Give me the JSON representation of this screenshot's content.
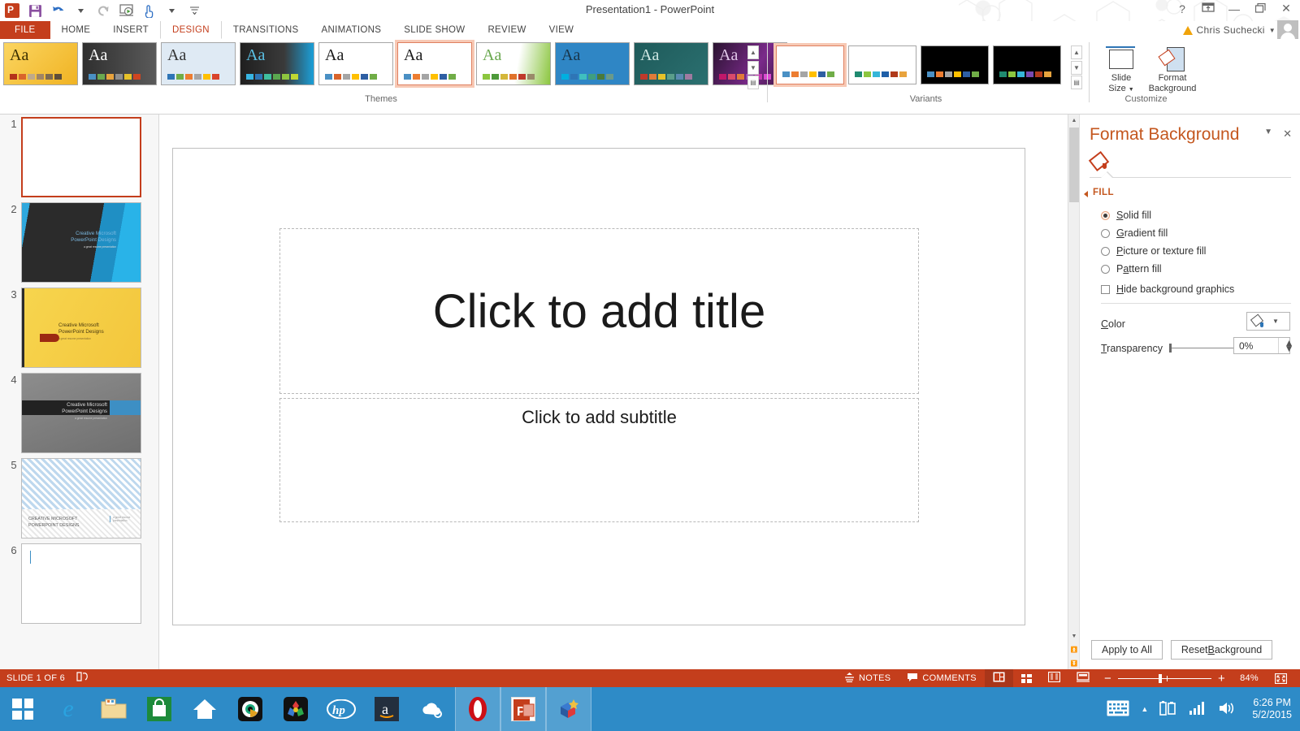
{
  "window": {
    "title": "Presentation1 - PowerPoint",
    "account_name": "Chris Suchecki",
    "help_icon": "?",
    "ribbon_display_icon": "ribbon-display-options-icon",
    "minimize_icon": "—",
    "restore_icon": "❐",
    "close_icon": "✕"
  },
  "quick_access": {
    "items": [
      {
        "name": "powerpoint-logo",
        "glyph": "P"
      },
      {
        "name": "save-icon",
        "glyph": "ὋE"
      },
      {
        "name": "undo-icon",
        "glyph": "↶"
      },
      {
        "name": "redo-icon",
        "glyph": "↻"
      },
      {
        "name": "start-slideshow-icon",
        "glyph": "▷"
      },
      {
        "name": "touch-mode-icon",
        "glyph": "☝"
      },
      {
        "name": "customize-qat-icon",
        "glyph": "≡"
      }
    ]
  },
  "tabs": {
    "file": "FILE",
    "items": [
      "HOME",
      "INSERT",
      "DESIGN",
      "TRANSITIONS",
      "ANIMATIONS",
      "SLIDE SHOW",
      "REVIEW",
      "VIEW"
    ],
    "active": "DESIGN"
  },
  "ribbon": {
    "groups": {
      "themes_label": "Themes",
      "variants_label": "Variants",
      "customize_label": "Customize"
    },
    "themes": [
      {
        "name": "theme-facet-gold",
        "aa": "Aa",
        "bg": "linear-gradient(135deg,#fbd560,#f0b323)",
        "aa_color": "#3b2f00",
        "swatches": [
          "#b5321a",
          "#d9642b",
          "#bfa98a",
          "#a08565",
          "#7d6a4f",
          "#5e4e39"
        ],
        "selected": false
      },
      {
        "name": "theme-ion-dark",
        "aa": "Aa",
        "bg": "linear-gradient(90deg,#2f2f2f,#5a5a5a)",
        "aa_color": "#ffffff",
        "swatches": [
          "#4a90c4",
          "#6aa84f",
          "#e8a33d",
          "#8f8f8f",
          "#e6c229",
          "#cf4520"
        ],
        "selected": false
      },
      {
        "name": "theme-wisp-pattern",
        "aa": "Aa",
        "bg": "#dfeaf4",
        "aa_color": "#333333",
        "swatches": [
          "#2e75b6",
          "#70ad47",
          "#ed7d31",
          "#a5a5a5",
          "#ffc000",
          "#d9442b"
        ],
        "selected": false
      },
      {
        "name": "theme-facet-blue",
        "aa": "Aa",
        "bg": "linear-gradient(90deg,#1f1f1f,#3a3a3a 60%,#1b9fd8)",
        "aa_color": "#5bc2e7",
        "swatches": [
          "#38b6e3",
          "#2e75b6",
          "#3fbf9f",
          "#5aa84f",
          "#8ec63f",
          "#bfd733"
        ],
        "selected": false
      },
      {
        "name": "theme-office-white",
        "aa": "Aa",
        "bg": "#ffffff",
        "aa_color": "#1a1a1a",
        "swatches": [
          "#4a90c4",
          "#d9642b",
          "#a5a5a5",
          "#ffc000",
          "#2e5fa3",
          "#70ad47"
        ],
        "selected": false
      },
      {
        "name": "theme-office-plain",
        "aa": "Aa",
        "bg": "#ffffff",
        "aa_color": "#1a1a1a",
        "swatches": [
          "#4a90c4",
          "#ed7d31",
          "#a5a5a5",
          "#ffc000",
          "#2e5fa3",
          "#70ad47"
        ],
        "selected": true
      },
      {
        "name": "theme-organic-green",
        "aa": "Aa",
        "bg": "linear-gradient(100deg,#ffffff 55%,#d7ebc0 70%,#8cc63f)",
        "aa_color": "#6aa84f",
        "swatches": [
          "#8cc63f",
          "#4e9a3a",
          "#d4b73a",
          "#e0722a",
          "#c0392b",
          "#9a8a6a"
        ],
        "selected": false
      },
      {
        "name": "theme-ion-boardroom",
        "aa": "Aa",
        "bg": "#2f86c5",
        "aa_color": "#18354a",
        "swatches": [
          "#00b0e0",
          "#2e75b6",
          "#3fbfbf",
          "#3f9e7f",
          "#4a7a3a",
          "#6a9a8a"
        ],
        "selected": false
      },
      {
        "name": "theme-retrospect-teal",
        "aa": "Aa",
        "bg": "linear-gradient(135deg,#1e5a5a,#2b7070)",
        "aa_color": "#cfe8e4",
        "swatches": [
          "#c0392b",
          "#e07b39",
          "#e6c229",
          "#5a9e8a",
          "#5a8ab0",
          "#a07aa0"
        ],
        "selected": false
      },
      {
        "name": "theme-slice-purple",
        "aa": "Aa",
        "bg": "linear-gradient(120deg,#2a1330,#7a2a8a 60%,#3a1540)",
        "aa_color": "#e2c8ea",
        "swatches": [
          "#c0186a",
          "#d94a6a",
          "#e07b39",
          "#9a4ab0",
          "#c43ab0",
          "#d94ad0"
        ],
        "selected": false
      }
    ],
    "variants": [
      {
        "name": "variant-light-1",
        "bg": "#ffffff",
        "swatches": [
          "#4a90c4",
          "#ed7d31",
          "#a5a5a5",
          "#ffc000",
          "#2e5fa3",
          "#70ad47"
        ],
        "selected": true
      },
      {
        "name": "variant-light-2",
        "bg": "#ffffff",
        "swatches": [
          "#1f8a70",
          "#8cc63f",
          "#35b6d8",
          "#1f5fa8",
          "#b03a1a",
          "#e8a33d"
        ],
        "selected": false
      },
      {
        "name": "variant-dark-1",
        "bg": "#000000",
        "swatches": [
          "#4a90c4",
          "#ed7d31",
          "#a5a5a5",
          "#ffc000",
          "#2e5fa3",
          "#70ad47"
        ],
        "selected": false
      },
      {
        "name": "variant-dark-2",
        "bg": "#000000",
        "swatches": [
          "#1f8a70",
          "#8cc63f",
          "#35b6d8",
          "#7a4ab0",
          "#b03a1a",
          "#e8a33d"
        ],
        "selected": false
      }
    ],
    "customize": {
      "slide_size_label_1": "Slide",
      "slide_size_label_2": "Size",
      "format_background_label_1": "Format",
      "format_background_label_2": "Background"
    }
  },
  "thumbnails": [
    {
      "num": "1",
      "name": "slide-thumb-1",
      "selected": true,
      "style": "blank",
      "title_line1": "",
      "title_line2": "",
      "subtitle": ""
    },
    {
      "num": "2",
      "name": "slide-thumb-2",
      "selected": false,
      "style": "facet-blue",
      "title_line1": "Creative Microsoft",
      "title_line2": "PowerPoint Designs",
      "subtitle": "a great resume presentation"
    },
    {
      "num": "3",
      "name": "slide-thumb-3",
      "selected": false,
      "style": "gold",
      "title_line1": "Creative Microsoft",
      "title_line2": "PowerPoint Designs",
      "subtitle": "a great resume presentation"
    },
    {
      "num": "4",
      "name": "slide-thumb-4",
      "selected": false,
      "style": "gray",
      "title_line1": "Creative Microsoft",
      "title_line2": "PowerPoint Designs",
      "subtitle": "a great resume presentation"
    },
    {
      "num": "5",
      "name": "slide-thumb-5",
      "selected": false,
      "style": "pattern",
      "title_line1": "CREATIVE MICROSOFT",
      "title_line2": "POWERPOINT DESIGNS",
      "subtitle": "a great resume presentation"
    },
    {
      "num": "6",
      "name": "slide-thumb-6",
      "selected": false,
      "style": "blank",
      "title_line1": "",
      "title_line2": "",
      "subtitle": ""
    }
  ],
  "slide": {
    "title_placeholder": "Click to add title",
    "subtitle_placeholder": "Click to add subtitle"
  },
  "format_background": {
    "title": "Format Background",
    "collapse_caret": "▼",
    "close": "✕",
    "fill_section_label": "FILL",
    "options": [
      {
        "name": "solid-fill-radio",
        "label_pre": "",
        "label_u": "S",
        "label_post": "olid fill",
        "checked": true
      },
      {
        "name": "gradient-fill-radio",
        "label_pre": "",
        "label_u": "G",
        "label_post": "radient fill",
        "checked": false
      },
      {
        "name": "picture-texture-fill-radio",
        "label_pre": "",
        "label_u": "P",
        "label_post": "icture or texture fill",
        "checked": false
      },
      {
        "name": "pattern-fill-radio",
        "label_pre": "P",
        "label_u": "a",
        "label_post": "ttern fill",
        "checked": false
      }
    ],
    "hide_graphics": {
      "pre": "",
      "u": "H",
      "post": "ide background graphics",
      "checked": false
    },
    "color_label_u": "C",
    "color_label_post": "olor",
    "transparency_label_u": "T",
    "transparency_label_post": "ransparency",
    "transparency_value": "0%",
    "apply_to_all": "Apply to All",
    "reset_background_pre": "Reset ",
    "reset_background_u": "B",
    "reset_background_post": "ackground"
  },
  "status_bar": {
    "slide_indicator": "SLIDE 1 OF 6",
    "language_icon": "language-icon",
    "notes": "NOTES",
    "comments": "COMMENTS",
    "views": [
      {
        "name": "normal-view-button",
        "active": true
      },
      {
        "name": "slide-sorter-view-button",
        "active": false
      },
      {
        "name": "reading-view-button",
        "active": false
      },
      {
        "name": "slideshow-view-button",
        "active": false
      }
    ],
    "zoom_out": "−",
    "zoom_in": "+",
    "zoom_level": "84%",
    "fit_to_window_icon": "fit-slide-to-window-icon"
  },
  "taskbar": {
    "start_label": "start-button",
    "apps": [
      {
        "name": "taskbar-internet-explorer",
        "glyph": "e",
        "color": "#1a9fe0",
        "bg": "transparent",
        "open": false
      },
      {
        "name": "taskbar-file-explorer",
        "glyph": "Ὄ1",
        "color": "#f5d27a",
        "bg": "transparent",
        "open": false
      },
      {
        "name": "taskbar-windows-store",
        "glyph": "ὬD",
        "color": "#ffffff",
        "bg": "#1d8a3a",
        "open": false
      },
      {
        "name": "taskbar-home",
        "glyph": "⌂",
        "color": "#ffffff",
        "bg": "transparent",
        "open": false
      },
      {
        "name": "taskbar-media-player",
        "glyph": "◉",
        "color": "#3ac0a0",
        "bg": "#111111",
        "open": false
      },
      {
        "name": "taskbar-apps-puzzle",
        "glyph": "❖",
        "color": "#e04a4a",
        "bg": "#111111",
        "open": false
      },
      {
        "name": "taskbar-hp",
        "glyph": "hp",
        "color": "#ffffff",
        "bg": "transparent",
        "open": false
      },
      {
        "name": "taskbar-amazon",
        "glyph": "a",
        "color": "#ffffff",
        "bg": "#232f3e",
        "open": false
      },
      {
        "name": "taskbar-cloud-drive",
        "glyph": "☁",
        "color": "#ffffff",
        "bg": "transparent",
        "open": false
      },
      {
        "name": "taskbar-opera",
        "glyph": "O",
        "color": "#cc0f16",
        "bg": "transparent",
        "open": true
      },
      {
        "name": "taskbar-powerpoint",
        "glyph": "P",
        "color": "#ffffff",
        "bg": "#c43e1c",
        "open": true
      },
      {
        "name": "taskbar-3d-app",
        "glyph": "▣",
        "color": "#e04a4a",
        "bg": "transparent",
        "open": true
      }
    ],
    "tray": {
      "keyboard_icon": "touch-keyboard-icon",
      "show_hidden_icon": "▲",
      "battery_icon": "battery-icon",
      "network_icon": "network-signal-icon",
      "volume_icon": "volume-icon",
      "time": "6:26 PM",
      "date": "5/2/2015"
    }
  }
}
